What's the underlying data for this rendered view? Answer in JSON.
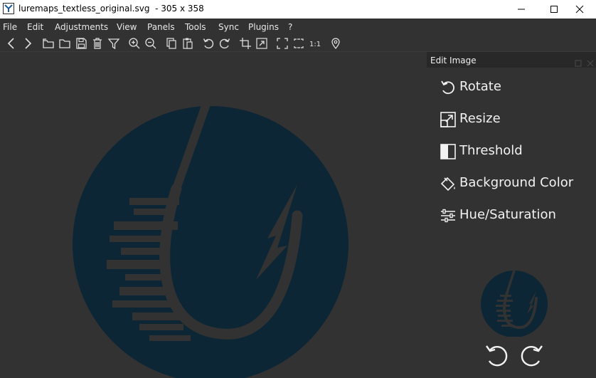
{
  "window": {
    "title": "luremaps_textless_original.svg  - 305 x 358",
    "app_icon": "app-logo-icon",
    "controls": [
      "minimize-icon",
      "maximize-icon",
      "close-icon"
    ]
  },
  "menu": {
    "items": [
      "File",
      "Edit",
      "Adjustments",
      "View",
      "Panels",
      "Tools",
      "Sync",
      "Plugins",
      "?"
    ]
  },
  "toolbar": {
    "icons": [
      "back-icon",
      "forward-icon",
      "open-folder-icon",
      "folder-icon",
      "save-icon",
      "delete-icon",
      "filter-icon",
      "zoom-in-icon",
      "zoom-out-icon",
      "copy-icon",
      "paste-icon",
      "rotate-left-icon",
      "rotate-right-icon",
      "crop-icon",
      "resize-icon",
      "fullscreen-icon",
      "fit-icon",
      "actual-size-icon",
      "location-icon"
    ],
    "actual_size_label": "1:1"
  },
  "panel": {
    "title": "Edit Image",
    "actions": [
      {
        "label": "Rotate",
        "icon": "rotate-icon"
      },
      {
        "label": "Resize",
        "icon": "resize-icon"
      },
      {
        "label": "Threshold",
        "icon": "threshold-icon"
      },
      {
        "label": "Background Color",
        "icon": "paint-bucket-icon"
      },
      {
        "label": "Hue/Saturation",
        "icon": "sliders-icon"
      }
    ],
    "thumbnail_icon": "lure-logo-thumbnail",
    "rotate_buttons": [
      "rotate-left-icon",
      "rotate-right-icon"
    ]
  },
  "image": {
    "logo_color": "#0c2635",
    "background_color": "#323232"
  }
}
